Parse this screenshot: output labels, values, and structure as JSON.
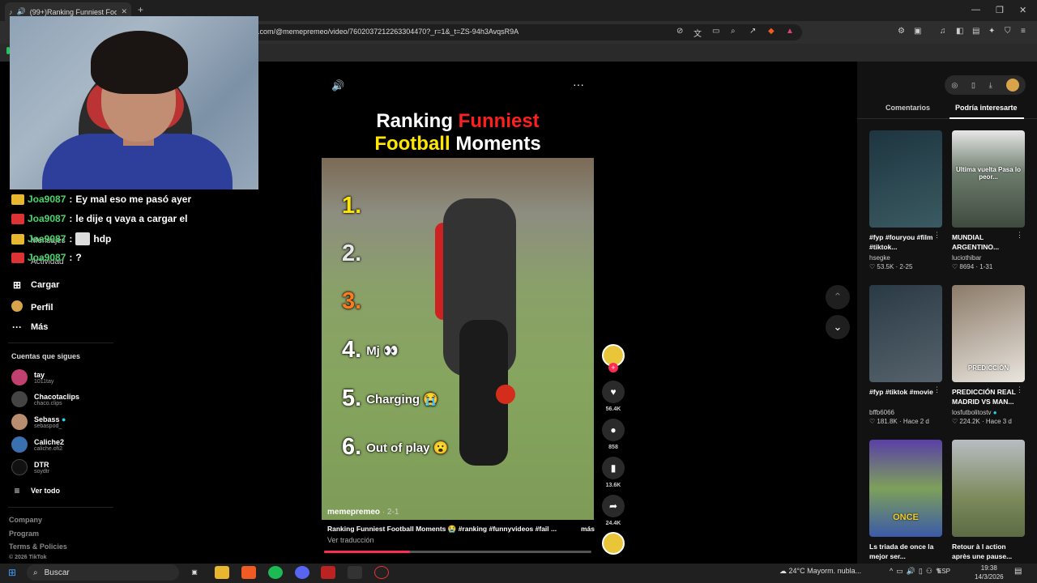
{
  "browser": {
    "tab_title": "(99+)Ranking Funniest Footb",
    "url": ".com/@memepremeo/video/7602037212263304470?_r=1&_t=ZS-94h3AvqsR9A"
  },
  "chat": [
    {
      "user": "Joa9087",
      "sep": ":",
      "message": "Ey mal eso me pasó ayer"
    },
    {
      "user": "Joa9087",
      "sep": ":",
      "message": "le dije q vaya a cargar el"
    },
    {
      "user": "Joa9087",
      "sep": ":",
      "message": "hdp"
    },
    {
      "user": "Joa9087",
      "sep": ":",
      "message": "?"
    }
  ],
  "sidebar": {
    "ghost_messages": "Mensajes",
    "ghost_activity": "Actividad",
    "items": [
      {
        "label": "Cargar",
        "icon": "plus-square-icon"
      },
      {
        "label": "Perfil",
        "icon": "profile-avatar-icon"
      },
      {
        "label": "Más",
        "icon": "more-dots-icon"
      }
    ],
    "following_header": "Cuentas que sigues",
    "accounts": [
      {
        "name": "tay",
        "handle": "1011tay",
        "color": "#c04070"
      },
      {
        "name": "Chacotaclips",
        "handle": "chaco.clips",
        "color": "#444"
      },
      {
        "name": "Sebass",
        "handle": "sebaspod_",
        "color": "#b98d6f"
      },
      {
        "name": "Caliche2",
        "handle": "caliche.ofi2",
        "color": "#3a6fb0"
      },
      {
        "name": "DTR",
        "handle": "soydtr",
        "color": "#111"
      }
    ],
    "see_all": "Ver todo",
    "footer": [
      "Company",
      "Program",
      "Terms & Policies",
      "© 2026 TikTok"
    ]
  },
  "video": {
    "title_part1": "Ranking",
    "title_part2": "Funniest",
    "title_part3": "Football",
    "title_part4": "Moments",
    "title_red": "#ff1f1f",
    "title_yellow": "#ffe600",
    "ranks": [
      {
        "num": "1.",
        "text": "",
        "color": "#ffe600"
      },
      {
        "num": "2.",
        "text": "",
        "color": "#e8e8e8"
      },
      {
        "num": "3.",
        "text": "",
        "color": "#ff7a1a"
      },
      {
        "num": "4.",
        "text": "Mj 👀",
        "color": "#ffffff"
      },
      {
        "num": "5.",
        "text": "Charging 😭",
        "color": "#ffffff"
      },
      {
        "num": "6.",
        "text": "Out of play 😮",
        "color": "#ffffff"
      }
    ],
    "author": "memepremeo",
    "date": "· 2-1",
    "caption": "Ranking Funniest Football Moments 😭 #ranking #funnyvideos #fail ...",
    "more": "más",
    "translate": "Ver traducción",
    "progress_fraction": 0.32
  },
  "actions": {
    "likes": "56.4K",
    "comments": "858",
    "saves": "13.6K",
    "shares": "24.4K"
  },
  "right_panel": {
    "tab_comments": "Comentarios",
    "tab_interesting": "Podría interesarte",
    "cards": [
      {
        "caption": "#fyp #fouryou #film #tiktok...",
        "author": "hsegke",
        "stats": "♡ 53.5K · 2-25",
        "bg": "#2b4a55",
        "overlay": ""
      },
      {
        "caption": "MUNDIAL ARGENTINO...",
        "author": "luciothibar",
        "stats": "♡ 8694 · 1-31",
        "bg": "#5a6a5a",
        "overlay": "Ultima vuelta Pasa lo peor..."
      },
      {
        "caption": "#fyp #tiktok #movie",
        "author": "bffb6066",
        "stats": "♡ 181.8K · Hace 2 d",
        "bg": "#3a4a55",
        "overlay": ""
      },
      {
        "caption": "PREDICCIÓN REAL MADRID VS MAN...",
        "author": "losfutbolitostv",
        "stats": "♡ 224.2K · Hace 3 d",
        "bg": "#8a7a6a",
        "overlay": "PREDICCIÓN"
      },
      {
        "caption": "Ls triada de once la mejor ser...",
        "author": "",
        "stats": "",
        "bg": "#3b5aa8",
        "overlay": "ONCE"
      },
      {
        "caption": "Retour à l action après une pause...",
        "author": "",
        "stats": "",
        "bg": "#6d7a5a",
        "overlay": ""
      }
    ]
  },
  "taskbar": {
    "search": "Buscar",
    "weather": "24°C  Mayorm. nubla...",
    "lang": "ESP",
    "time": "19:38",
    "date": "14/3/2026"
  }
}
